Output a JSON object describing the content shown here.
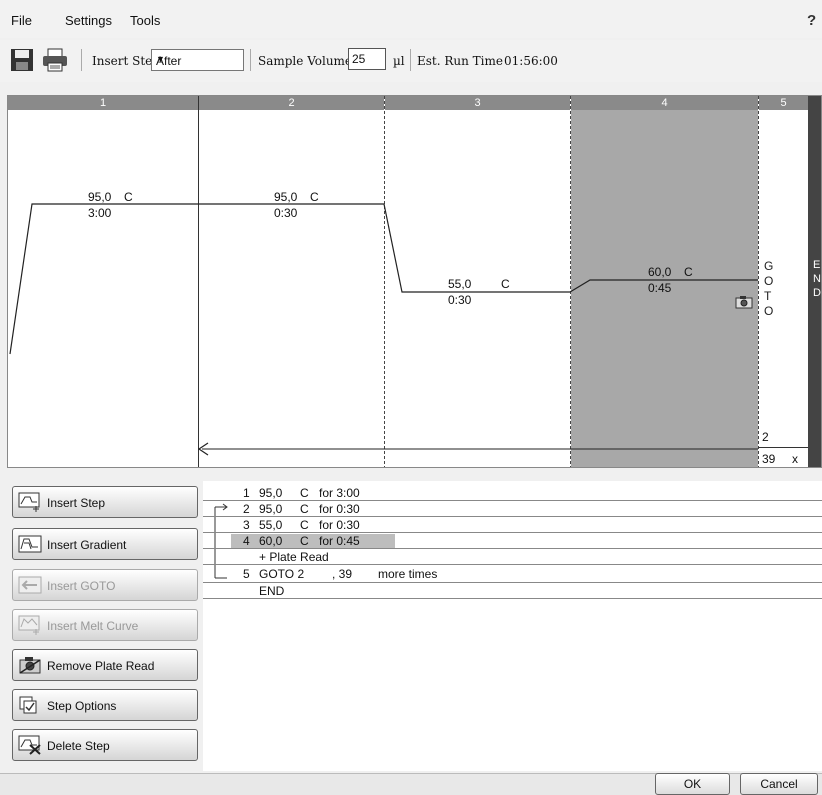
{
  "menu": {
    "file": "File",
    "settings": "Settings",
    "tools": "Tools",
    "help": "?"
  },
  "toolbar": {
    "insert_step_label": "Insert Step",
    "insert_position": "After",
    "sample_volume_label": "Sample Volume",
    "sample_volume_value": "25",
    "volume_unit": "µl",
    "run_time_label": "Est. Run Time",
    "run_time_value": "01:56:00"
  },
  "protocol": {
    "columns": [
      "1",
      "2",
      "3",
      "4",
      "5"
    ],
    "steps": [
      {
        "temp": "95,0",
        "unit": "C",
        "time": "3:00"
      },
      {
        "temp": "95,0",
        "unit": "C",
        "time": "0:30"
      },
      {
        "temp": "55,0",
        "unit": "C",
        "time": "0:30"
      },
      {
        "temp": "60,0",
        "unit": "C",
        "time": "0:45"
      }
    ],
    "goto_letters": [
      "G",
      "O",
      "T",
      "O"
    ],
    "end_letters": [
      "E",
      "N",
      "D"
    ],
    "goto_target": "2",
    "goto_repeats": "39",
    "goto_x": "x"
  },
  "buttons": {
    "insert_step": "Insert Step",
    "insert_gradient": "Insert Gradient",
    "insert_goto": "Insert GOTO",
    "insert_melt_curve": "Insert Melt Curve",
    "remove_plate_read": "Remove Plate Read",
    "step_options": "Step Options",
    "delete_step": "Delete Step"
  },
  "list": [
    {
      "num": "1",
      "temp": "95,0",
      "unit": "C",
      "desc": "for 3:00"
    },
    {
      "num": "2",
      "temp": "95,0",
      "unit": "C",
      "desc": "for 0:30"
    },
    {
      "num": "3",
      "temp": "55,0",
      "unit": "C",
      "desc": "for 0:30"
    },
    {
      "num": "4",
      "temp": "60,0",
      "unit": "C",
      "desc": "for 0:45"
    }
  ],
  "list_extra": {
    "plate_read": "+ Plate Read",
    "goto_num": "5",
    "goto_text": "GOTO 2",
    "goto_count": ", 39",
    "goto_more": "more times",
    "end": "END"
  },
  "dialog": {
    "ok": "OK",
    "cancel": "Cancel"
  }
}
